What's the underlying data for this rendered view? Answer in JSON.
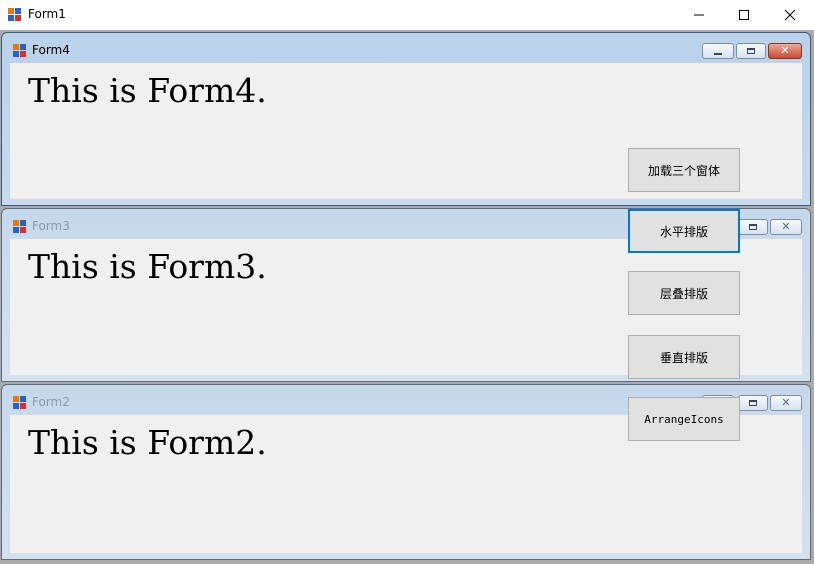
{
  "main_window": {
    "title": "Form1",
    "controls": {
      "minimize": "—",
      "maximize": "☐",
      "close": "✕"
    }
  },
  "children": [
    {
      "title": "Form4",
      "message": "This is Form4.",
      "state": "active"
    },
    {
      "title": "Form3",
      "message": "This is Form3.",
      "state": "inactive"
    },
    {
      "title": "Form2",
      "message": "This is Form2.",
      "state": "inactive"
    }
  ],
  "buttons": {
    "load": "加载三个窗体",
    "tile_horizontal": "水平排版",
    "cascade": "层叠排版",
    "tile_vertical": "垂直排版",
    "arrange_icons": "ArrangeIcons"
  },
  "colors": {
    "focus_border": "#0078d7",
    "active_close": "#c94c33"
  }
}
